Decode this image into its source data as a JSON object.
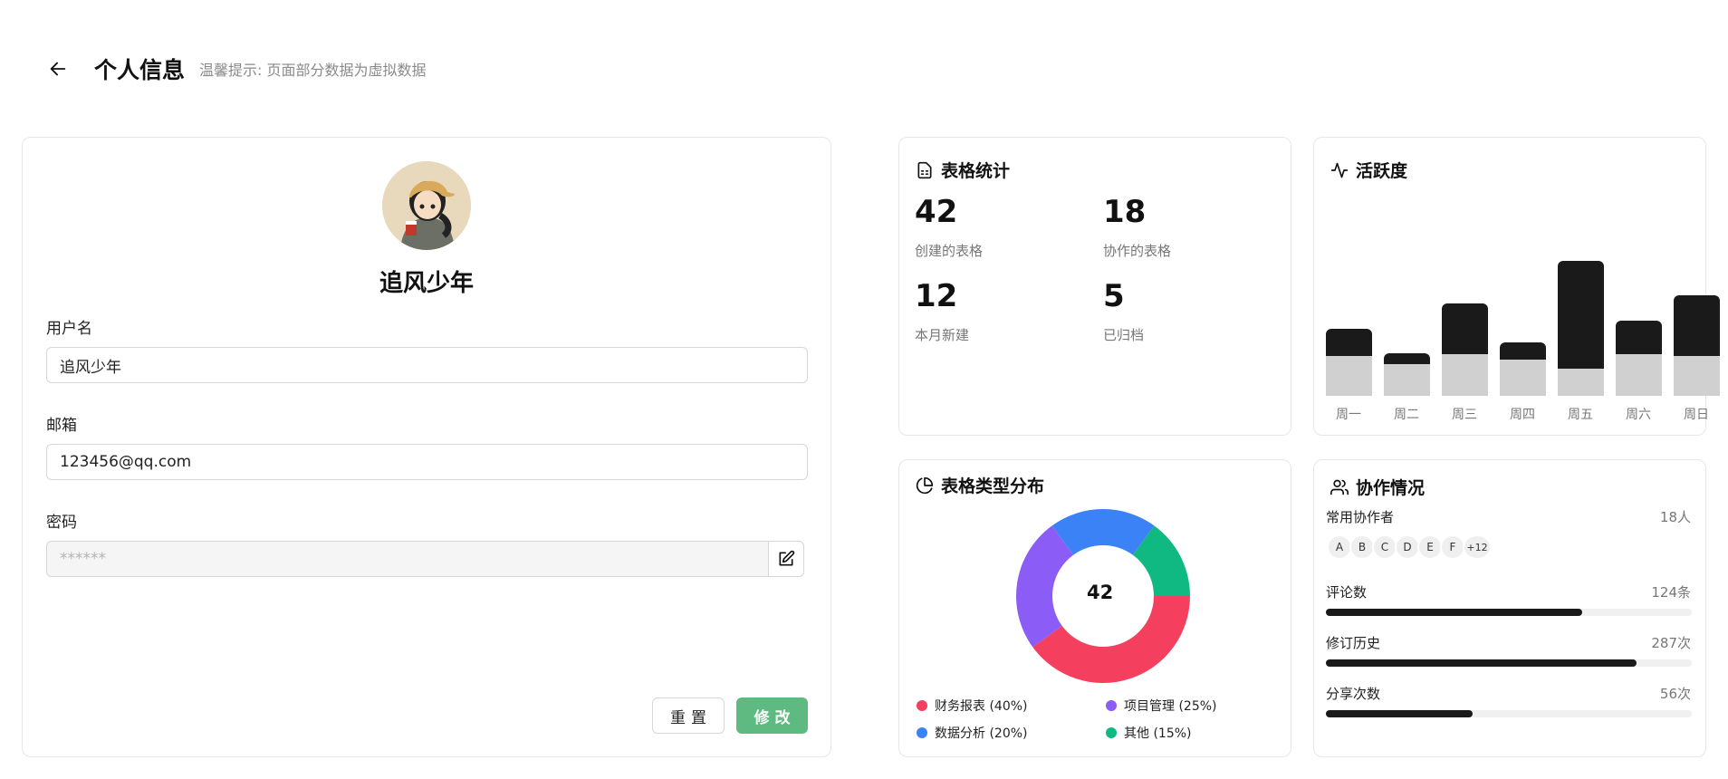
{
  "header": {
    "title": "个人信息",
    "hint": "温馨提示: 页面部分数据为虚拟数据"
  },
  "profile": {
    "name": "追风少年",
    "fields": {
      "username_label": "用户名",
      "username_value": "追风少年",
      "email_label": "邮箱",
      "email_value": "123456@qq.com",
      "password_label": "密码",
      "password_placeholder": "******"
    },
    "reset_label": "重置",
    "submit_label": "修改",
    "submit_color": "#5fba82"
  },
  "stats": {
    "title": "表格统计",
    "items": [
      {
        "value": "42",
        "label": "创建的表格"
      },
      {
        "value": "18",
        "label": "协作的表格"
      },
      {
        "value": "12",
        "label": "本月新建"
      },
      {
        "value": "5",
        "label": "已归档"
      }
    ]
  },
  "activity": {
    "title": "活跃度",
    "days": [
      "周一",
      "周二",
      "周三",
      "周四",
      "周五",
      "周六",
      "周日"
    ],
    "top_values": [
      30,
      12,
      56,
      19,
      119,
      37,
      67
    ],
    "bottom_values": [
      44,
      35,
      46,
      40,
      30,
      46,
      44
    ]
  },
  "distribution": {
    "title": "表格类型分布",
    "center_value": "42",
    "items": [
      {
        "label": "财务报表 (40%)",
        "percent": 40,
        "color": "#f43f5e"
      },
      {
        "label": "项目管理 (25%)",
        "percent": 25,
        "color": "#8b5cf6"
      },
      {
        "label": "数据分析 (20%)",
        "percent": 20,
        "color": "#3b82f6"
      },
      {
        "label": "其他 (15%)",
        "percent": 15,
        "color": "#10b981"
      }
    ]
  },
  "collab": {
    "title": "协作情况",
    "collaborators_label": "常用协作者",
    "collaborators_count": "18人",
    "avatars": [
      "A",
      "B",
      "C",
      "D",
      "E",
      "F",
      "+12"
    ],
    "metrics": [
      {
        "label": "评论数",
        "value": "124条",
        "fraction": 0.7
      },
      {
        "label": "修订历史",
        "value": "287次",
        "fraction": 0.85
      },
      {
        "label": "分享次数",
        "value": "56次",
        "fraction": 0.4
      }
    ]
  }
}
